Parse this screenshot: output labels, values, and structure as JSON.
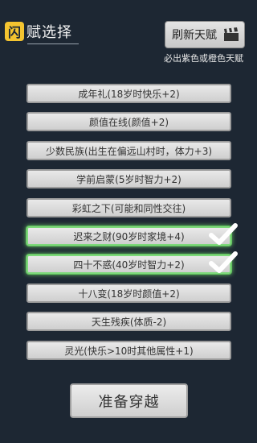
{
  "header": {
    "logo_char": "闪",
    "title": "赋选择"
  },
  "refresh": {
    "label": "刷新天赋",
    "note": "必出紫色或橙色天赋"
  },
  "talents": [
    {
      "label": "成年礼(18岁时快乐+2)",
      "selected": false
    },
    {
      "label": "颜值在线(颜值+2)",
      "selected": false
    },
    {
      "label": "少数民族(出生在偏远山村时，体力+3)",
      "selected": false
    },
    {
      "label": "学前启蒙(5岁时智力+2)",
      "selected": false
    },
    {
      "label": "彩虹之下(可能和同性交往)",
      "selected": false
    },
    {
      "label": "迟来之财(90岁时家境+4)",
      "selected": true
    },
    {
      "label": "四十不惑(40岁时智力+2)",
      "selected": true
    },
    {
      "label": "十八变(18岁时颜值+2)",
      "selected": false
    },
    {
      "label": "天生残疾(体质-2)",
      "selected": false
    },
    {
      "label": "灵光(快乐>10时其他属性+1)",
      "selected": false
    }
  ],
  "start": {
    "label": "准备穿越"
  },
  "colors": {
    "background": "#1d2733",
    "selected_glow": "#7dd87a",
    "logo": "#f4c430"
  }
}
